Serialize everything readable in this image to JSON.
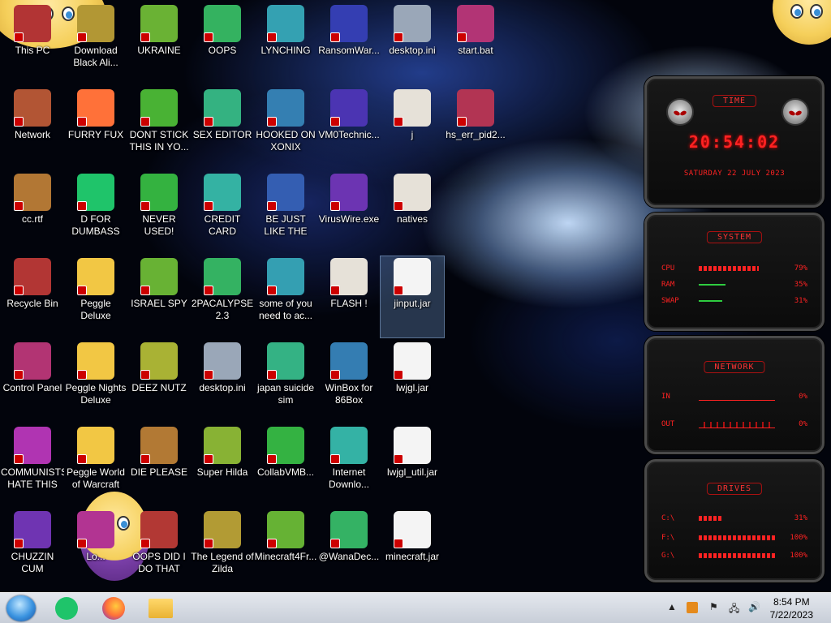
{
  "desktop": {
    "icons": [
      {
        "label": "This PC",
        "icon": "this-pc-icon"
      },
      {
        "label": "Download Black Ali...",
        "icon": "download-icon"
      },
      {
        "label": "UKRAINE",
        "icon": "radiation-icon"
      },
      {
        "label": "OOPS",
        "icon": "oops-icon"
      },
      {
        "label": "LYNCHING",
        "icon": "lynching-icon"
      },
      {
        "label": "RansomWar...",
        "icon": "skull-icon"
      },
      {
        "label": "desktop.ini",
        "icon": "settings-file-icon"
      },
      {
        "label": "start.bat",
        "icon": "batch-file-icon"
      },
      {
        "label": "Network",
        "icon": "network-icon"
      },
      {
        "label": "FURRY FUX",
        "icon": "firefox-icon"
      },
      {
        "label": "DONT STICK THIS IN YO...",
        "icon": "vlc-icon"
      },
      {
        "label": "SEX EDITOR",
        "icon": "hxd-icon"
      },
      {
        "label": "HOOKED ON XONIX",
        "icon": "xonix-icon"
      },
      {
        "label": "VM0Technic...",
        "icon": "doctor-icon"
      },
      {
        "label": "j",
        "icon": "folder-icon"
      },
      {
        "label": "hs_err_pid2...",
        "icon": "txt-file-icon"
      },
      {
        "label": "cc.rtf",
        "icon": "rtf-file-icon"
      },
      {
        "label": "D FOR DUMBASS",
        "icon": "green-app-icon"
      },
      {
        "label": "NEVER USED!",
        "icon": "devcpp-icon"
      },
      {
        "label": "CREDIT CARD CHECKER",
        "icon": "credit-card-icon"
      },
      {
        "label": "BE JUST LIKE THE DUDE!",
        "icon": "dude-icon"
      },
      {
        "label": "VirusWire.exe",
        "icon": "lime-icon"
      },
      {
        "label": "natives",
        "icon": "folder-icon"
      },
      {
        "label": "Recycle Bin",
        "icon": "recycle-bin-icon"
      },
      {
        "label": "Peggle Deluxe",
        "icon": "peggle-icon"
      },
      {
        "label": "ISRAEL SPY",
        "icon": "spy-icon"
      },
      {
        "label": "2PACALYPSE 2.3",
        "icon": "terminal-icon"
      },
      {
        "label": "some of you need to ac...",
        "icon": "beaver-icon"
      },
      {
        "label": "FLASH !",
        "icon": "folder-icon"
      },
      {
        "label": "jinput.jar",
        "icon": "java-icon"
      },
      {
        "label": "Control Panel",
        "icon": "control-panel-icon"
      },
      {
        "label": "Peggle Nights Deluxe",
        "icon": "peggle-icon"
      },
      {
        "label": "DEEZ NUTZ",
        "icon": "copy-icon"
      },
      {
        "label": "desktop.ini",
        "icon": "settings-file-icon"
      },
      {
        "label": "japan suicide sim",
        "icon": "document-icon"
      },
      {
        "label": "WinBox for 86Box",
        "icon": "winbox-icon"
      },
      {
        "label": "lwjgl.jar",
        "icon": "java-icon"
      },
      {
        "label": "COMMUNISTS HATE THIS G...",
        "icon": "money-bag-icon"
      },
      {
        "label": "Peggle World of Warcraft",
        "icon": "peggle-icon"
      },
      {
        "label": "DIE PLEASE",
        "icon": "de-icon"
      },
      {
        "label": "Super Hilda",
        "icon": "pixel-cat-icon"
      },
      {
        "label": "CollabVMB...",
        "icon": "monitor-icon"
      },
      {
        "label": "Internet Downlo...",
        "icon": "idm-icon"
      },
      {
        "label": "lwjgl_util.jar",
        "icon": "java-icon"
      },
      {
        "label": "CHUZZIN CUM",
        "icon": "chuzzle-icon"
      },
      {
        "label": "Lo...",
        "icon": "unknown-icon"
      },
      {
        "label": "OOPS DID I DO THAT",
        "icon": "portrait-icon"
      },
      {
        "label": "The Legend of Zilda",
        "icon": "zelda-icon"
      },
      {
        "label": "Minecraft4Fr...",
        "icon": "minecraft-icon"
      },
      {
        "label": "@WanaDec...",
        "icon": "wannacry-icon"
      },
      {
        "label": "minecraft.jar",
        "icon": "java-icon"
      }
    ]
  },
  "widget": {
    "time_title": "TIME",
    "time": "20:54:02",
    "date": "Saturday 22 July 2023",
    "system_title": "SYSTEM",
    "cpu_label": "CPU",
    "cpu_value": "79%",
    "cpu_level": 0.79,
    "ram_label": "RAM",
    "ram_value": "35%",
    "ram_level": 0.35,
    "swap_label": "SWAP",
    "swap_value": "31%",
    "swap_level": 0.31,
    "network_title": "NETWORK",
    "in_label": "IN",
    "in_value": "0%",
    "out_label": "OUT",
    "out_value": "0%",
    "drives_title": "DRIVES",
    "drive_c_label": "C:\\",
    "drive_c_value": "31%",
    "drive_c_level": 0.31,
    "drive_f_label": "F:\\",
    "drive_f_value": "100%",
    "drive_f_level": 1.0,
    "drive_g_label": "G:\\",
    "drive_g_value": "100%",
    "drive_g_level": 1.0
  },
  "taskbar": {
    "apps": [
      "green-app-icon",
      "firefox-icon",
      "file-explorer-icon"
    ],
    "time": "8:54 PM",
    "date": "7/22/2023",
    "colors": {
      "accent": "#ff2222",
      "taskbar": "#d6dbe3"
    }
  }
}
